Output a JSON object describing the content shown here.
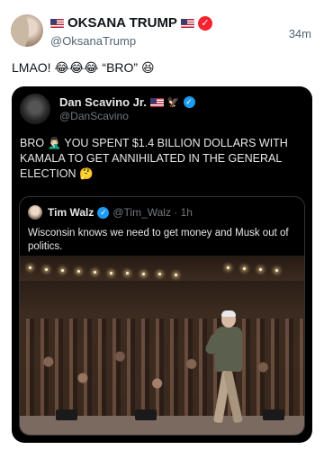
{
  "tweet": {
    "display_name": "OKSANA TRUMP",
    "handle": "@OksanaTrump",
    "time": "34m",
    "text": "LMAO! 😂😂😂 “BRO” 😆"
  },
  "quoted": {
    "display_name": "Dan Scavino Jr.",
    "handle": "@DanScavino",
    "text": "BRO 🤦🏻‍♂️ YOU SPENT $1.4 BILLION DOLLARS WITH KAMALA TO GET ANNIHILATED IN THE GENERAL ELECTION 🤔"
  },
  "nested": {
    "display_name": "Tim Walz",
    "handle_time": "@Tim_Walz · 1h",
    "text": "Wisconsin knows we need to get money and Musk out of politics."
  },
  "colors": {
    "verified_red": "#f4212e",
    "verified_blue": "#1d9bf0",
    "quote_bg": "#000000"
  },
  "icons": {
    "outer_verified": "verified-badge-icon",
    "quoted_verified": "verified-badge-icon",
    "flag": "us-flag-icon"
  }
}
